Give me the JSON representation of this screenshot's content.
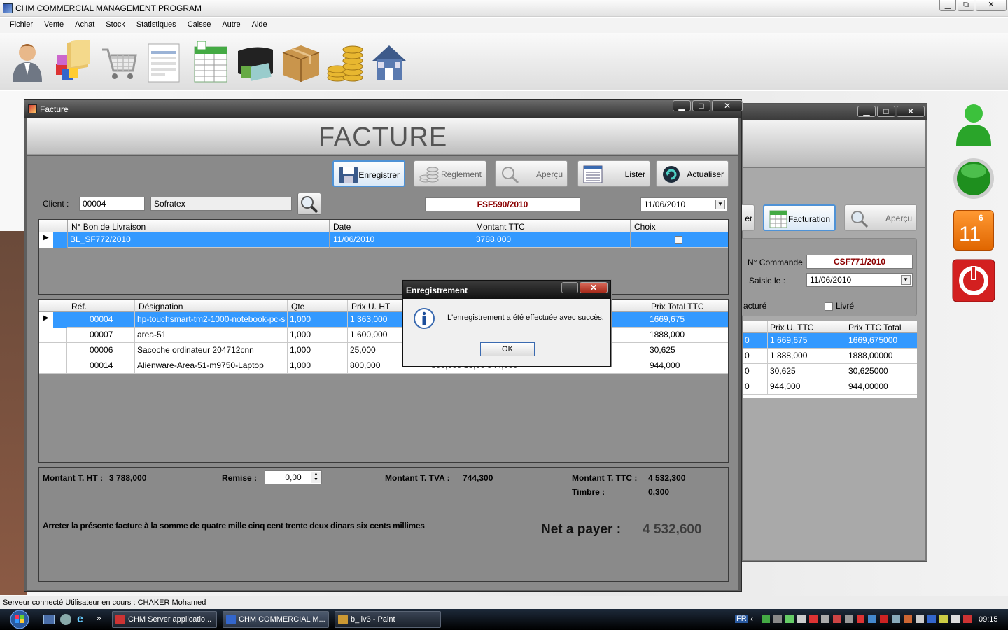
{
  "app": {
    "title": "CHM COMMERCIAL MANAGEMENT PROGRAM"
  },
  "menu": [
    "Fichier",
    "Vente",
    "Achat",
    "Stock",
    "Statistiques",
    "Caisse",
    "Autre",
    "Aide"
  ],
  "toolbar_icons": [
    "user-icon",
    "folder-cubes-icon",
    "cart-icon",
    "invoice-form-icon",
    "spreadsheet-icon",
    "wallet-card-icon",
    "package-box-icon",
    "coins-icon",
    "home-icon"
  ],
  "side_badges": {
    "calendar_month": "6",
    "calendar_day": "11"
  },
  "back_window": {
    "btn_partial": "er",
    "btn_facturation": "Facturation",
    "btn_apercu": "Aperçu",
    "commande_label": "N° Commande :",
    "commande_value": "CSF771/2010",
    "saisie_label": "Saisie le :",
    "saisie_value": "11/06/2010",
    "facture_partial": "acturé",
    "livre_label": "Livré",
    "columns": [
      "Prix U. TTC",
      "Prix TTC Total"
    ],
    "rows": [
      {
        "c0": "0",
        "c1": "1 669,675",
        "c2": "1669,675000"
      },
      {
        "c0": "0",
        "c1": "1 888,000",
        "c2": "1888,00000"
      },
      {
        "c0": "0",
        "c1": "30,625",
        "c2": "30,625000"
      },
      {
        "c0": "0",
        "c1": "944,000",
        "c2": "944,00000"
      }
    ]
  },
  "window": {
    "title": "Facture",
    "banner": "FACTURE",
    "buttons": {
      "enregistrer": "Enregistrer",
      "reglement": "Règlement",
      "apercu": "Aperçu",
      "lister": "Lister",
      "actualiser": "Actualiser"
    },
    "client_label": "Client :",
    "client_code": "00004",
    "client_name": "Sofratex",
    "facture_num": "FSF590/2010",
    "date": "11/06/2010"
  },
  "livraisons": {
    "columns": [
      "N° Bon de Livraison",
      "Date",
      "Montant TTC",
      "Choix"
    ],
    "rows": [
      {
        "num": "BL_SF772/2010",
        "date": "11/06/2010",
        "montant": "3788,000",
        "choix": false
      }
    ]
  },
  "articles": {
    "columns": [
      "Réf.",
      "Désignation",
      "Qte",
      "Prix U. HT",
      "Prix Total TTC"
    ],
    "rows": [
      {
        "ref": "00004",
        "designation": "hp-touchsmart-tm2-1000-notebook-pc-series",
        "qte": "1,000",
        "prix": "1 363,000",
        "total": "1669,675",
        "hidden": ""
      },
      {
        "ref": "00007",
        "designation": "area-51",
        "qte": "1,000",
        "prix": "1 600,000",
        "total": "1888,000",
        "hidden": ""
      },
      {
        "ref": "00006",
        "designation": "Sacoche ordinateur 204712cnn",
        "qte": "1,000",
        "prix": "25,000",
        "total": "30,625",
        "hidden": ""
      },
      {
        "ref": "00014",
        "designation": "Alienware-Area-51-m9750-Laptop",
        "qte": "1,000",
        "prix": "800,000",
        "total": "944,000",
        "hidden": "800,000     18,00     944,000"
      }
    ]
  },
  "totals": {
    "ht_label": "Montant T. HT :",
    "ht_value": "3 788,000",
    "remise_label": "Remise :",
    "remise_value": "0,00",
    "tva_label": "Montant T. TVA :",
    "tva_value": "744,300",
    "ttc_label": "Montant T. TTC :",
    "ttc_value": "4 532,300",
    "timbre_label": "Timbre :",
    "timbre_value": "0,300",
    "words": "Arreter la présente facture à la somme de quatre mille cinq cent trente deux dinars six cents millimes",
    "net_label": "Net a payer :",
    "net_value": "4 532,600"
  },
  "dialog": {
    "title": "Enregistrement",
    "message": "L'enregistrement a été effectuée avec succès.",
    "ok": "OK"
  },
  "status": "Serveur connecté   Utilisateur en cours : CHAKER Mohamed",
  "taskbar": {
    "tasks": [
      "CHM Server applicatio...",
      "CHM COMMERCIAL M...",
      "b_liv3 - Paint"
    ],
    "lang": "FR",
    "time": "09:15"
  }
}
